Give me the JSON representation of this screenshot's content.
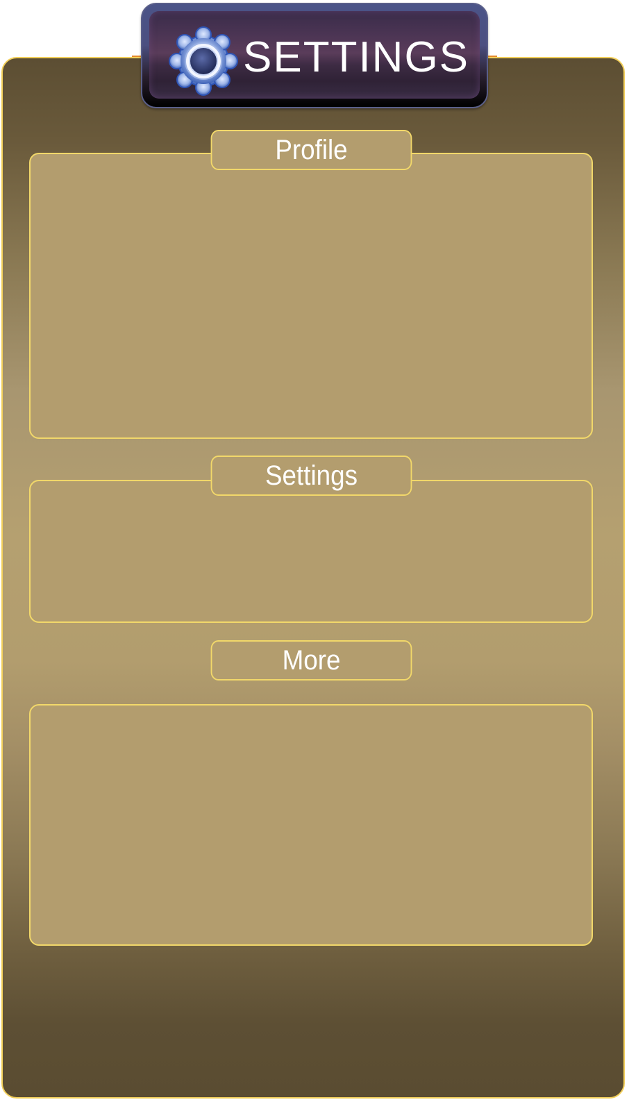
{
  "header": {
    "title": "SETTINGS",
    "icon": "gear-icon"
  },
  "sections": [
    {
      "label": "Profile"
    },
    {
      "label": "Settings"
    },
    {
      "label": "More"
    }
  ],
  "colors": {
    "panel_border": "#f2cf5a",
    "section_fill": "#b39d6e",
    "section_border": "#f2d86a",
    "header_bg": "#4b5488",
    "accent": "#e58a2b",
    "text": "#ffffff"
  }
}
